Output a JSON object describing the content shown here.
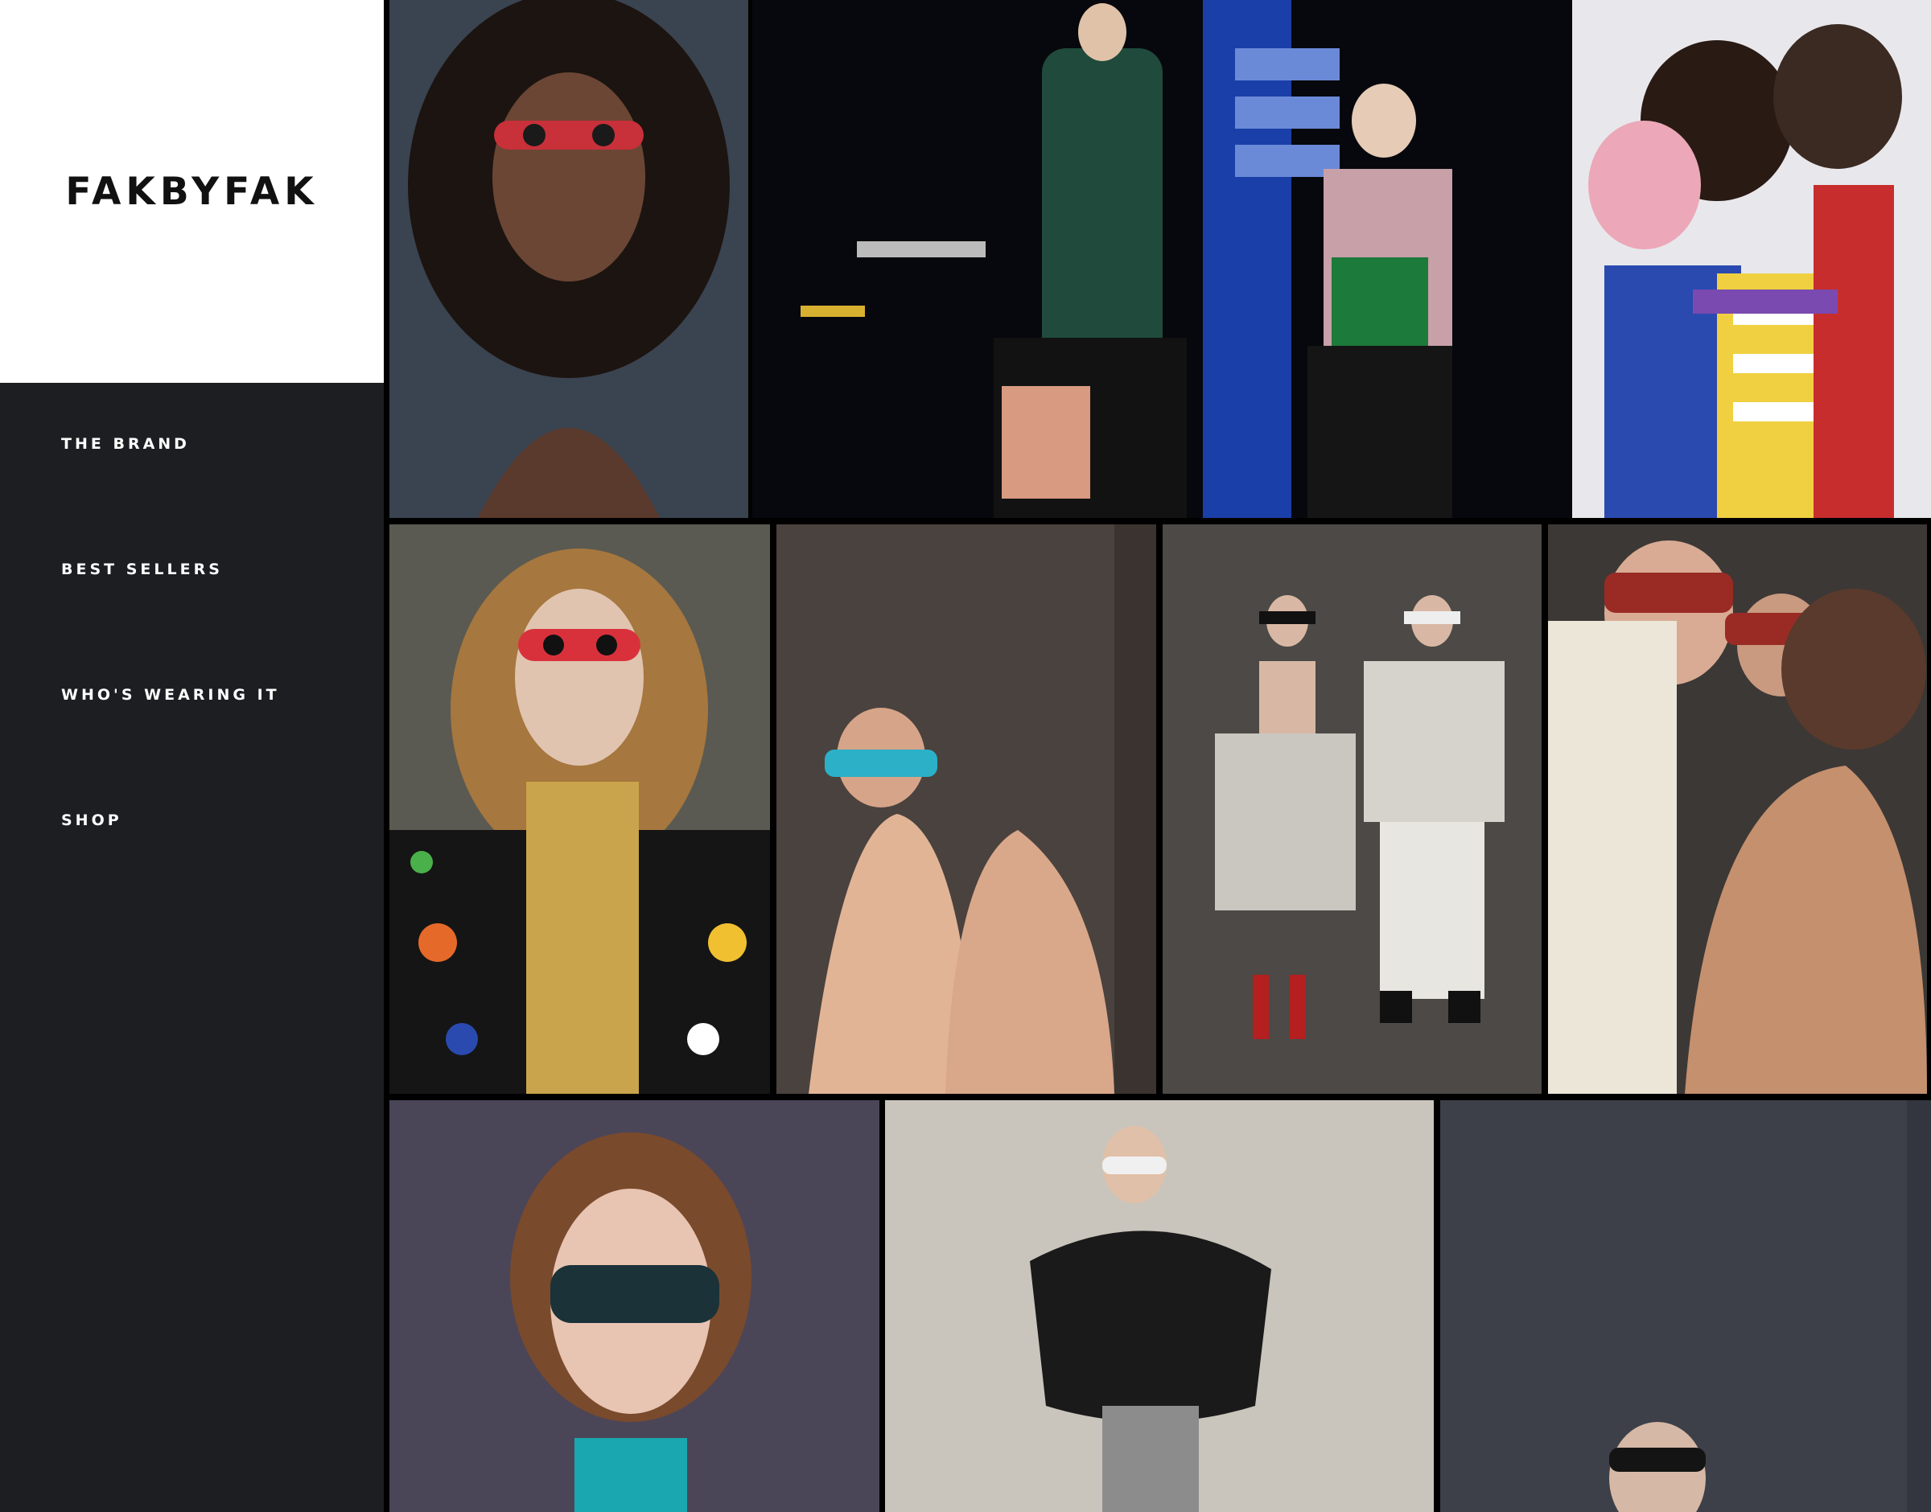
{
  "brand": {
    "logo": "FAKBYFAK"
  },
  "nav": {
    "items": [
      {
        "label": "THE BRAND"
      },
      {
        "label": "BEST SELLERS"
      },
      {
        "label": "WHO'S WEARING IT"
      },
      {
        "label": "SHOP"
      }
    ]
  },
  "gallery": {
    "tiles": [
      {
        "name": "curly-hair-model-photo",
        "bg": "#3a4350",
        "accent": "#c8303a"
      },
      {
        "name": "night-gas-station-photo",
        "bg": "#07080d",
        "accent": "#1b3fa8"
      },
      {
        "name": "hugging-colorful-models-photo",
        "bg": "#e8e8ec",
        "accent": "#2a4ab0"
      },
      {
        "name": "runway-floral-jacket-photo",
        "bg": "#5a5a52",
        "accent": "#d9313c"
      },
      {
        "name": "nude-pose-shades-photo",
        "bg": "#4a423e",
        "accent": "#2bb0c8"
      },
      {
        "name": "two-models-standing-photo",
        "bg": "#4c4946",
        "accent": "#b42020"
      },
      {
        "name": "group-skin-tones-photo",
        "bg": "#3c3836",
        "accent": "#9a2b24"
      },
      {
        "name": "aviator-model-photo",
        "bg": "#4b4558",
        "accent": "#1aa7b0"
      },
      {
        "name": "black-fur-model-photo",
        "bg": "#c9c5bc",
        "accent": "#1a1a1a"
      },
      {
        "name": "grey-backdrop-model-photo",
        "bg": "#3d4048",
        "accent": "#141414"
      }
    ]
  }
}
